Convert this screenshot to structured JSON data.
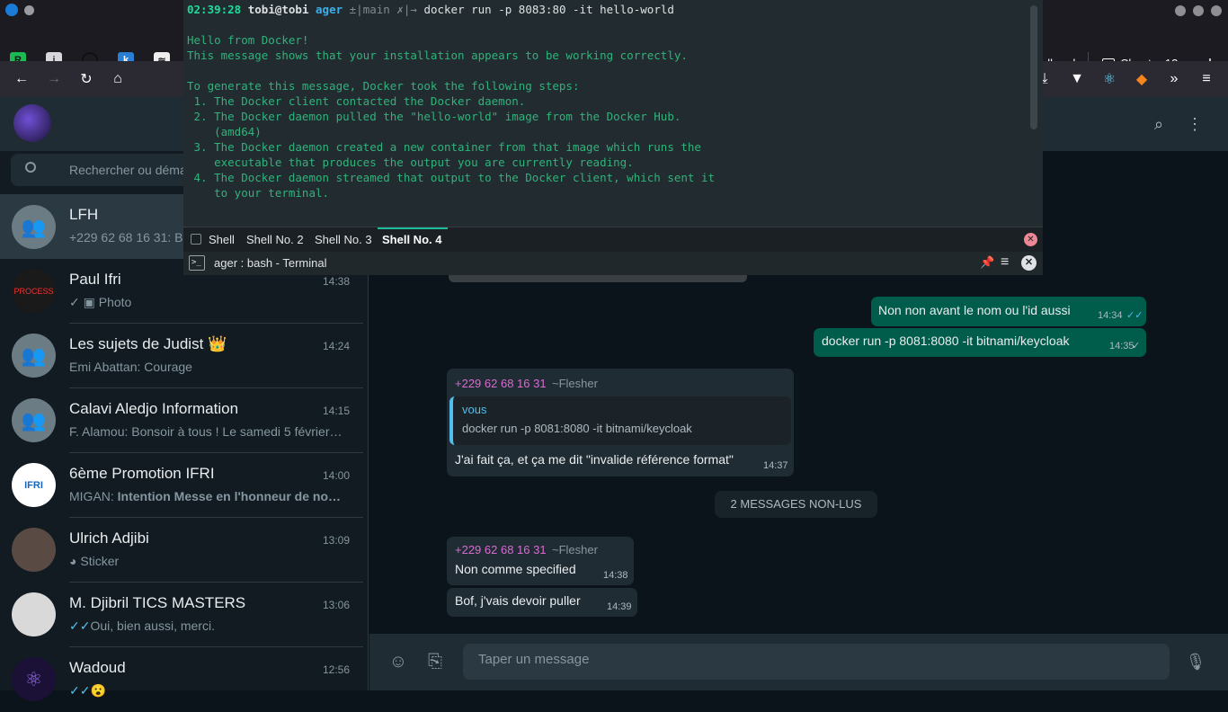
{
  "browser": {
    "tabs_visible": [
      {
        "label": "all and"
      },
      {
        "label": "Chapter 13"
      }
    ],
    "new_tab": "+"
  },
  "terminal": {
    "prompt_time": "02:39:28",
    "prompt_user": "tobi@tobi",
    "prompt_dir": "ager",
    "prompt_git": "±|main ✗|→",
    "command": "docker run -p 8083:80 -it hello-world",
    "output_lines": [
      "",
      "Hello from Docker!",
      "This message shows that your installation appears to be working correctly.",
      "",
      "To generate this message, Docker took the following steps:",
      " 1. The Docker client contacted the Docker daemon.",
      " 2. The Docker daemon pulled the \"hello-world\" image from the Docker Hub.",
      "    (amd64)",
      " 3. The Docker daemon created a new container from that image which runs the",
      "    executable that produces the output you are currently reading.",
      " 4. The Docker daemon streamed that output to the Docker client, which sent it",
      "    to your terminal."
    ],
    "tabs": [
      "Shell",
      "Shell No. 2",
      "Shell No. 3",
      "Shell No. 4"
    ],
    "active_tab": "Shell No. 4",
    "status_title": "ager : bash - Terminal"
  },
  "whatsapp": {
    "search_placeholder": "Rechercher ou démarrer une discussion",
    "chats": [
      {
        "name": "LFH",
        "preview": "+229 62 68 16 31: B",
        "time": ""
      },
      {
        "name": "Paul Ifri",
        "preview": "Photo",
        "time": "14:38"
      },
      {
        "name": "Les sujets de Judist 👑",
        "preview": "Emi Abattan: Courage",
        "time": "14:24"
      },
      {
        "name": "Calavi Aledjo Information",
        "preview": "F. Alamou: Bonsoir à tous ! Le samedi 5 février…",
        "time": "14:15"
      },
      {
        "name": "6ème Promotion IFRI",
        "preview_sender": "MIGAN:",
        "preview": "Intention Messe en l'honneur de no…",
        "time": "14:00"
      },
      {
        "name": "Ulrich Adjibi",
        "preview": "Sticker",
        "time": "13:09"
      },
      {
        "name": "M. Djibril TICS MASTERS",
        "preview": "Oui, bien aussi, merci.",
        "time": "13:06"
      },
      {
        "name": "Wadoud",
        "preview": "✓✓😮",
        "time": "12:56"
      }
    ],
    "messages": {
      "out1": {
        "text": "Non non avant le nom ou l'id aussi",
        "time": "14:34"
      },
      "out2": {
        "text": "docker run -p 8081:8080 -it bitnami/keycloak",
        "time": "14:35"
      },
      "in1": {
        "sender": "+229 62 68 16 31",
        "alias": "~Flesher",
        "quote_author": "vous",
        "quote_text": "docker run -p 8081:8080 -it bitnami/keycloak",
        "text": "J'ai fait ça, et ça me dit \"invalide référence format\"",
        "time": "14:37"
      },
      "unread": "2 MESSAGES NON-LUS",
      "in2": {
        "sender": "+229 62 68 16 31",
        "alias": "~Flesher",
        "text": "Non comme specified",
        "time": "14:38"
      },
      "in3": {
        "text": "Bof, j'vais devoir puller",
        "time": "14:39"
      }
    },
    "composer_placeholder": "Taper un message"
  },
  "colors": {
    "terminal_text": "#2fb37b",
    "wa_out_bubble": "#005c4b",
    "wa_in_bubble": "#202c33",
    "sender_name": "#d96ad0"
  }
}
